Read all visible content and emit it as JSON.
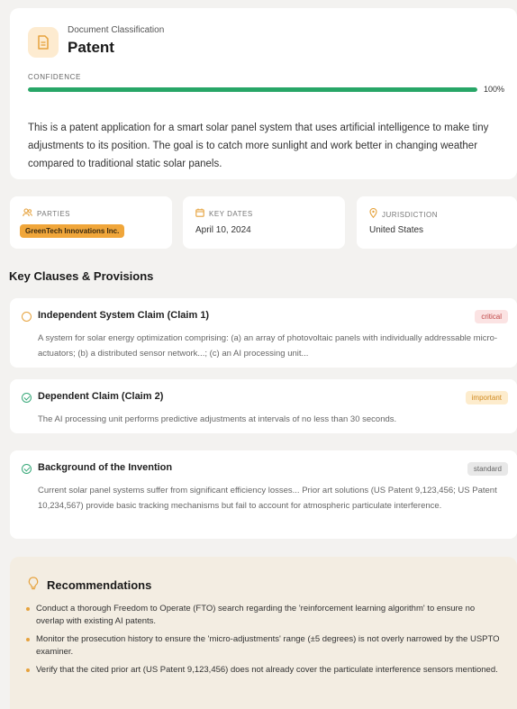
{
  "classification": {
    "subtitle": "Document Classification",
    "title": "Patent",
    "icon": "document-icon",
    "confidence_label": "CONFIDENCE",
    "confidence_value": "100%",
    "confidence_fraction": 1.0,
    "summary": "This is a patent application for a smart solar panel system that uses artificial intelligence to make tiny adjustments to its position. The goal is to catch more sunlight and work better in changing weather compared to traditional static solar panels."
  },
  "info": {
    "parties": {
      "label": "PARTIES",
      "icon": "users-icon",
      "badge": "GreenTech Innovations Inc."
    },
    "key_dates": {
      "label": "KEY DATES",
      "icon": "calendar-icon",
      "value": "April 10, 2024"
    },
    "jurisdiction": {
      "label": "JURISDICTION",
      "icon": "location-pin-icon",
      "value": "United States"
    }
  },
  "clauses_section": {
    "title": "Key Clauses & Provisions",
    "items": [
      {
        "title": "Independent System Claim (Claim 1)",
        "tag": "critical",
        "icon": "circle-alert-icon",
        "text": "A system for solar energy optimization comprising: (a) an array of photovoltaic panels with individually addressable micro-actuators; (b) a distributed sensor network...; (c) an AI processing unit..."
      },
      {
        "title": "Dependent Claim (Claim 2)",
        "tag": "important",
        "icon": "circle-check-icon",
        "text": "The AI processing unit performs predictive adjustments at intervals of no less than 30 seconds."
      },
      {
        "title": "Background of the Invention",
        "tag": "standard",
        "icon": "circle-check-icon",
        "text": "Current solar panel systems suffer from significant efficiency losses... Prior art solutions (US Patent 9,123,456; US Patent 10,234,567) provide basic tracking mechanisms but fail to account for atmospheric particulate interference."
      }
    ]
  },
  "recommendations": {
    "title": "Recommendations",
    "icon": "lightbulb-icon",
    "items": [
      "Conduct a thorough Freedom to Operate (FTO) search regarding the 'reinforcement learning algorithm' to ensure no overlap with existing AI patents.",
      "Monitor the prosecution history to ensure the 'micro-adjustments' range (±5 degrees) is not overly narrowed by the USPTO examiner.",
      "Verify that the cited prior art (US Patent 9,123,456) does not already cover the particulate interference sensors mentioned."
    ]
  },
  "colors": {
    "accent": "#e6a23c",
    "confidence_bar": "#27a667",
    "critical": "#c04848",
    "important": "#d08a20"
  }
}
